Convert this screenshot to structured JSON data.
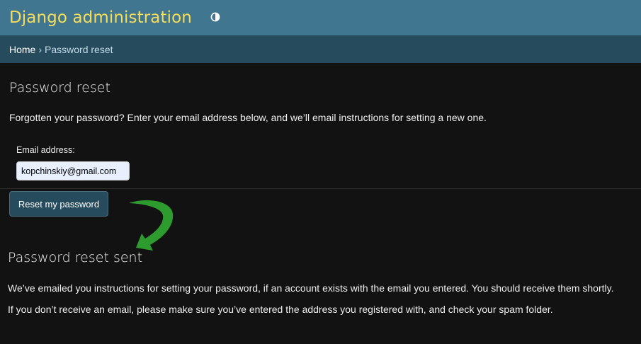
{
  "header": {
    "site_name": "Django administration",
    "theme_toggle_icon": "half-circle-contrast-icon"
  },
  "breadcrumbs": {
    "home": "Home",
    "separator": "›",
    "current": "Password reset"
  },
  "reset_form": {
    "title": "Password reset",
    "intro": "Forgotten your password? Enter your email address below, and we’ll email instructions for setting a new one.",
    "email_label": "Email address:",
    "email_value": "kopchinskiy@gmail.com",
    "submit_label": "Reset my password"
  },
  "annotation": {
    "arrow_icon": "curved-arrow-down-icon",
    "arrow_color": "#2e9b2e"
  },
  "reset_sent": {
    "title": "Password reset sent",
    "message_1": "We’ve emailed you instructions for setting your password, if an account exists with the email you entered. You should receive them shortly.",
    "message_2": "If you don’t receive an email, please make sure you’ve entered the address you registered with, and check your spam folder."
  },
  "colors": {
    "header_bg": "#417690",
    "brand": "#f5dd5d",
    "breadcrumb_bg": "#264b5d",
    "page_bg": "#121212",
    "button_bg": "#264b5d"
  }
}
